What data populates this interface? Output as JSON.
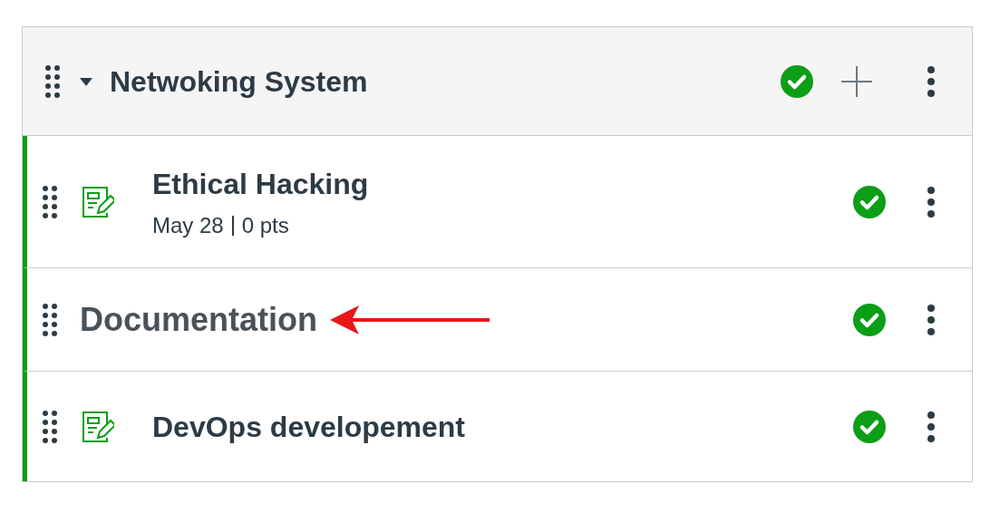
{
  "module": {
    "title": "Netwoking System",
    "expanded": true,
    "published": true
  },
  "items": [
    {
      "kind": "assignment",
      "title": "Ethical Hacking",
      "meta": [
        "May 28",
        "0 pts"
      ],
      "published": true
    },
    {
      "kind": "subheader",
      "title": "Documentation",
      "published": true
    },
    {
      "kind": "assignment",
      "title": "DevOps developement",
      "published": true
    }
  ]
}
